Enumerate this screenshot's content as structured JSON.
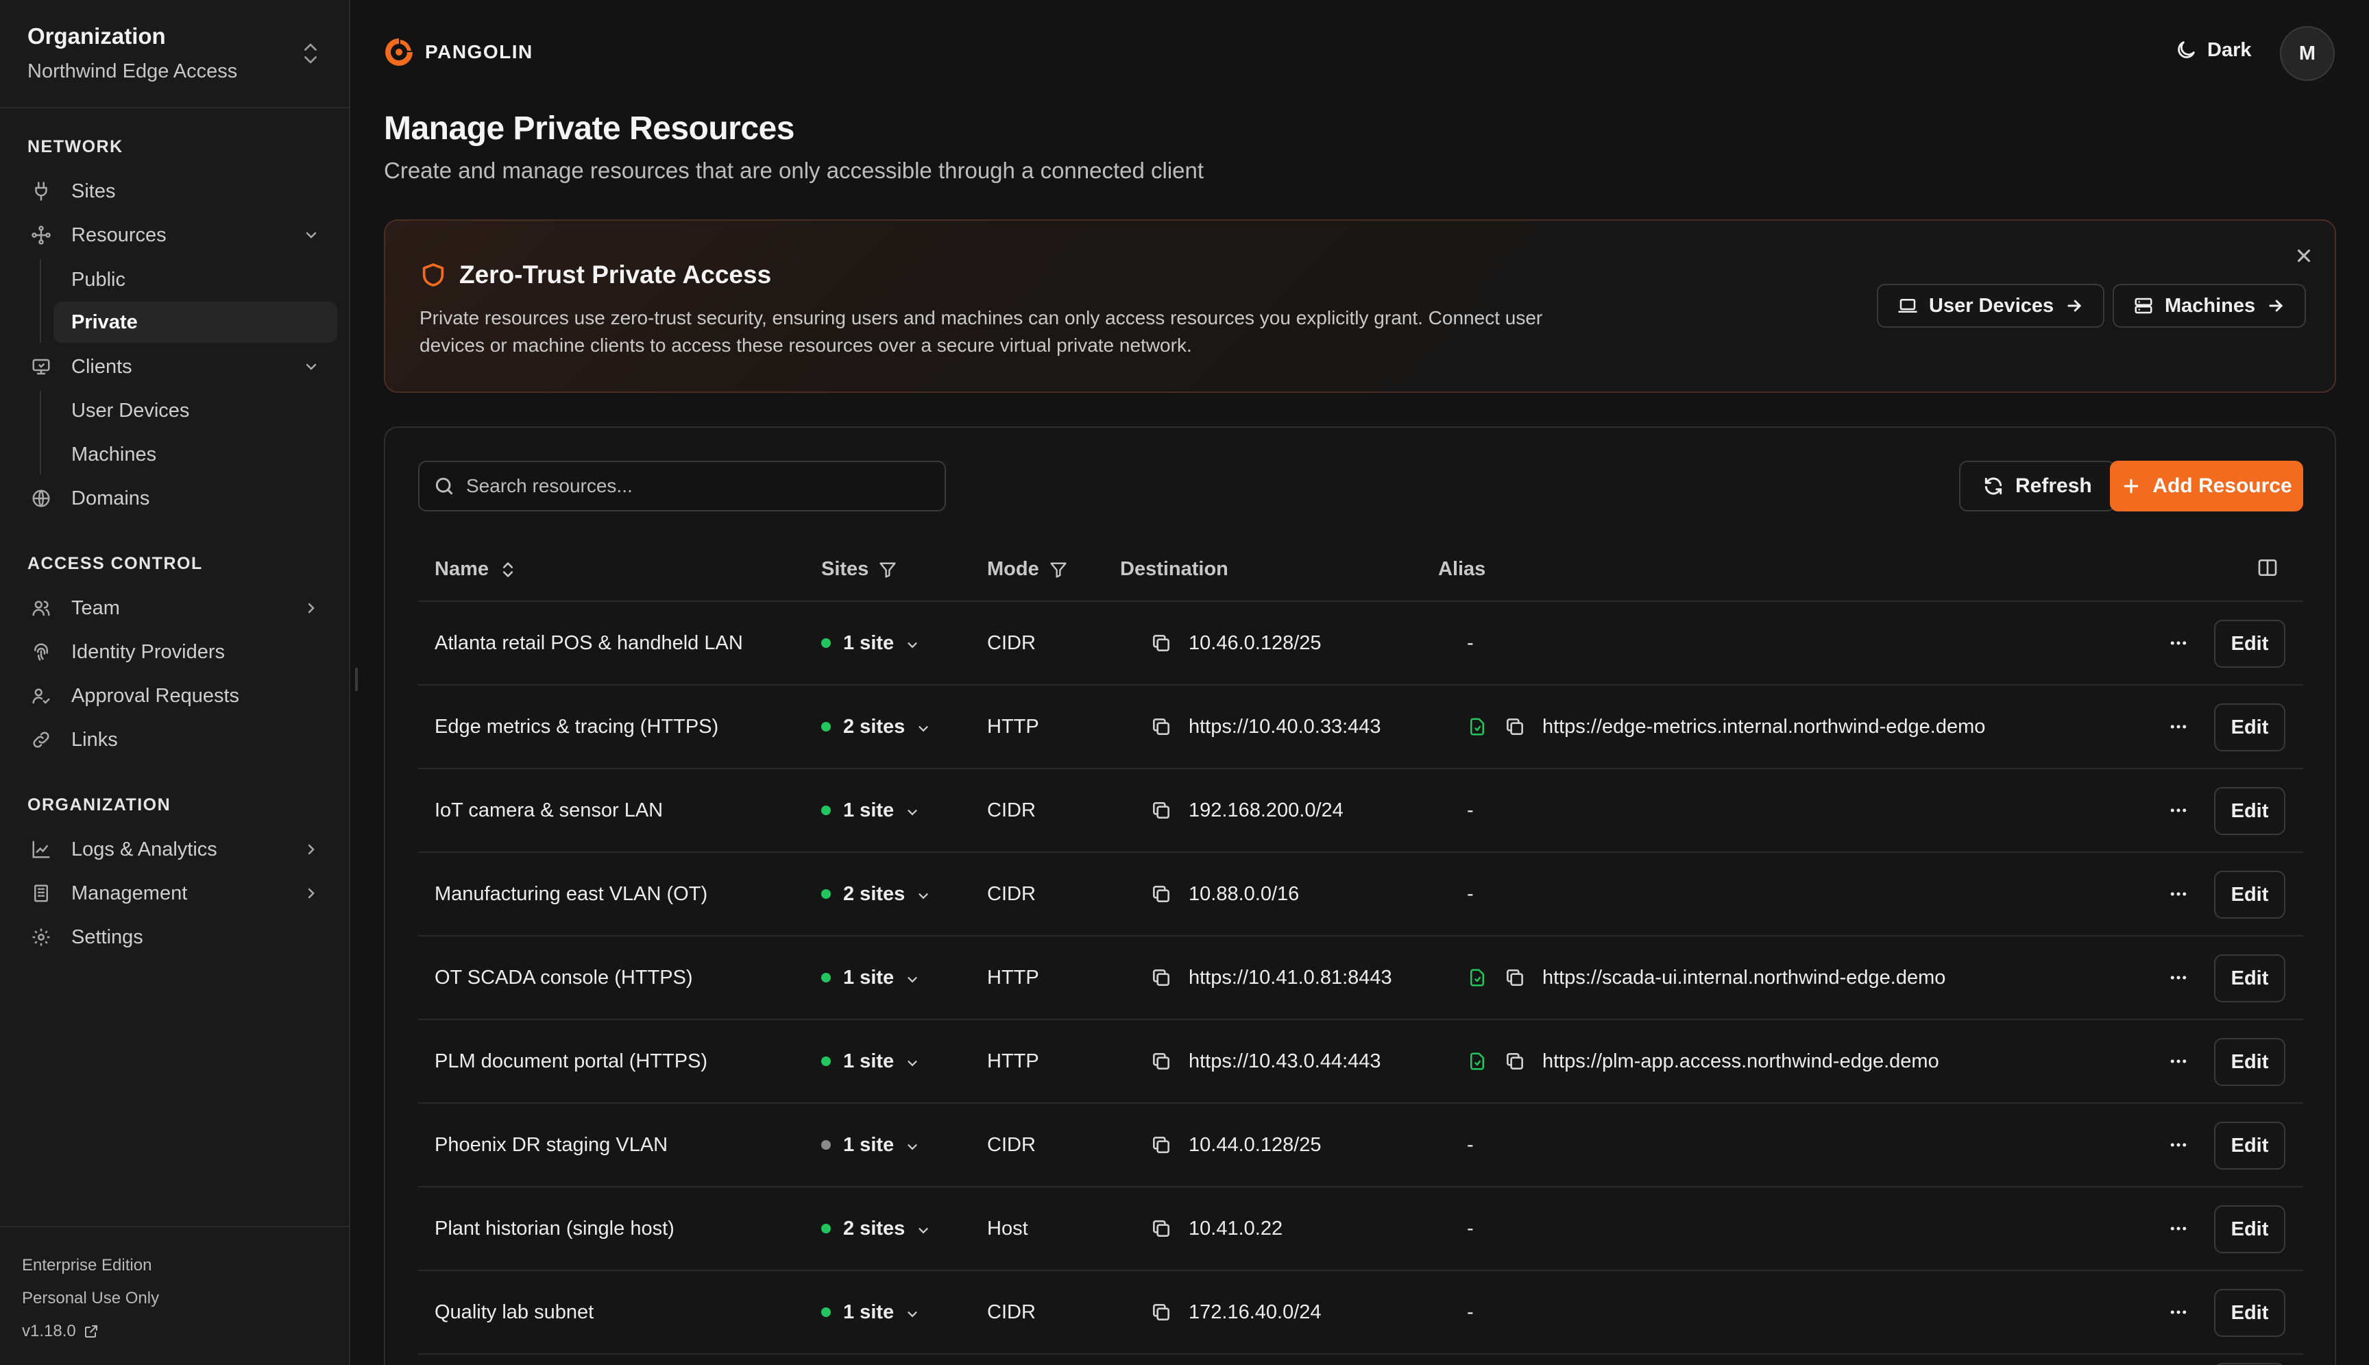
{
  "sidebar": {
    "org_title": "Organization",
    "org_name": "Northwind Edge Access",
    "sections": {
      "network": "NETWORK",
      "access_control": "ACCESS CONTROL",
      "organization": "ORGANIZATION"
    },
    "items": {
      "sites": "Sites",
      "resources": "Resources",
      "public": "Public",
      "private": "Private",
      "clients": "Clients",
      "user_devices": "User Devices",
      "machines": "Machines",
      "domains": "Domains",
      "team": "Team",
      "identity_providers": "Identity Providers",
      "approval_requests": "Approval Requests",
      "links": "Links",
      "logs_analytics": "Logs & Analytics",
      "management": "Management",
      "settings": "Settings"
    },
    "footer": {
      "edition": "Enterprise Edition",
      "license": "Personal Use Only",
      "version": "v1.18.0"
    }
  },
  "header": {
    "brand": "PANGOLIN",
    "theme_label": "Dark",
    "avatar_initial": "M",
    "brand_color": "#f26b1f"
  },
  "page": {
    "title": "Manage Private Resources",
    "subtitle": "Create and manage resources that are only accessible through a connected client"
  },
  "banner": {
    "title": "Zero-Trust Private Access",
    "text": "Private resources use zero-trust security, ensuring users and machines can only access resources you explicitly grant. Connect user devices or machine clients to access these resources over a secure virtual private network.",
    "user_devices_label": "User Devices",
    "machines_label": "Machines"
  },
  "toolbar": {
    "search_placeholder": "Search resources...",
    "refresh_label": "Refresh",
    "add_label": "Add Resource"
  },
  "table": {
    "columns": {
      "name": "Name",
      "sites": "Sites",
      "mode": "Mode",
      "destination": "Destination",
      "alias": "Alias"
    },
    "edit_label": "Edit",
    "rows": [
      {
        "name": "Atlanta retail POS & handheld LAN",
        "sites": "1 site",
        "status": "online",
        "mode": "CIDR",
        "destination": "10.46.0.128/25",
        "alias": "-"
      },
      {
        "name": "Edge metrics & tracing (HTTPS)",
        "sites": "2 sites",
        "status": "online",
        "mode": "HTTP",
        "destination": "https://10.40.0.33:443",
        "alias": "https://edge-metrics.internal.northwind-edge.demo"
      },
      {
        "name": "IoT camera & sensor LAN",
        "sites": "1 site",
        "status": "online",
        "mode": "CIDR",
        "destination": "192.168.200.0/24",
        "alias": "-"
      },
      {
        "name": "Manufacturing east VLAN (OT)",
        "sites": "2 sites",
        "status": "online",
        "mode": "CIDR",
        "destination": "10.88.0.0/16",
        "alias": "-"
      },
      {
        "name": "OT SCADA console (HTTPS)",
        "sites": "1 site",
        "status": "online",
        "mode": "HTTP",
        "destination": "https://10.41.0.81:8443",
        "alias": "https://scada-ui.internal.northwind-edge.demo"
      },
      {
        "name": "PLM document portal (HTTPS)",
        "sites": "1 site",
        "status": "online",
        "mode": "HTTP",
        "destination": "https://10.43.0.44:443",
        "alias": "https://plm-app.access.northwind-edge.demo"
      },
      {
        "name": "Phoenix DR staging VLAN",
        "sites": "1 site",
        "status": "offline",
        "mode": "CIDR",
        "destination": "10.44.0.128/25",
        "alias": "-"
      },
      {
        "name": "Plant historian (single host)",
        "sites": "2 sites",
        "status": "online",
        "mode": "Host",
        "destination": "10.41.0.22",
        "alias": "-"
      },
      {
        "name": "Quality lab subnet",
        "sites": "1 site",
        "status": "online",
        "mode": "CIDR",
        "destination": "172.16.40.0/24",
        "alias": "-"
      }
    ]
  }
}
